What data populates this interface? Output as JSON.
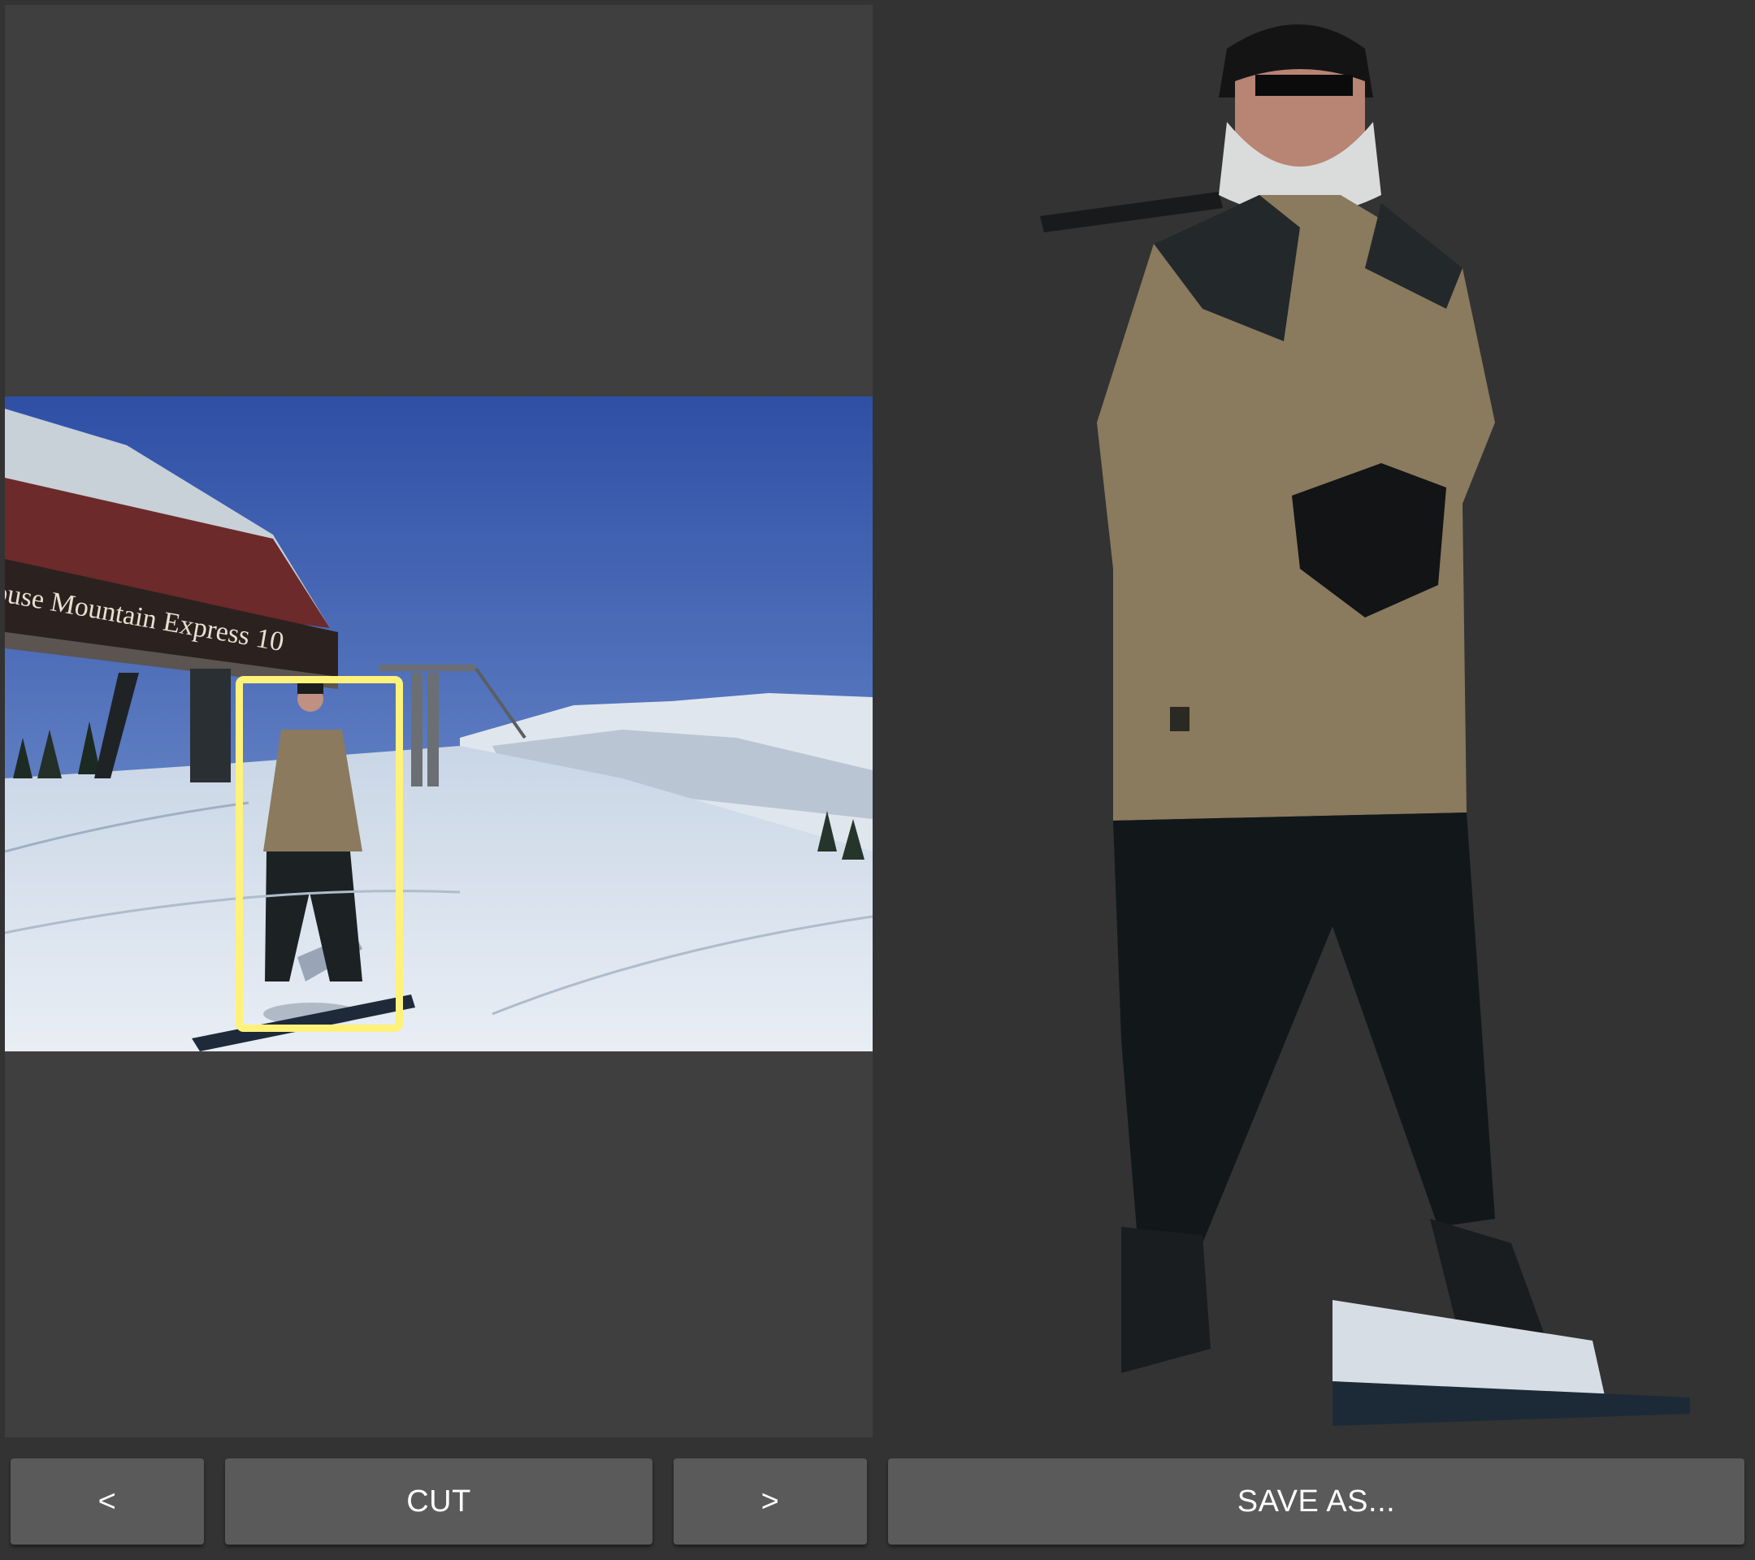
{
  "photo": {
    "sign_text": "ouse Mountain Express 10"
  },
  "toolbar": {
    "prev_label": "<",
    "cut_label": "CUT",
    "next_label": ">",
    "save_label": "SAVE AS..."
  },
  "colors": {
    "selection": "#fff27a",
    "button": "#5a5a5a",
    "panel": "#3f3f3f",
    "background": "#333333"
  }
}
